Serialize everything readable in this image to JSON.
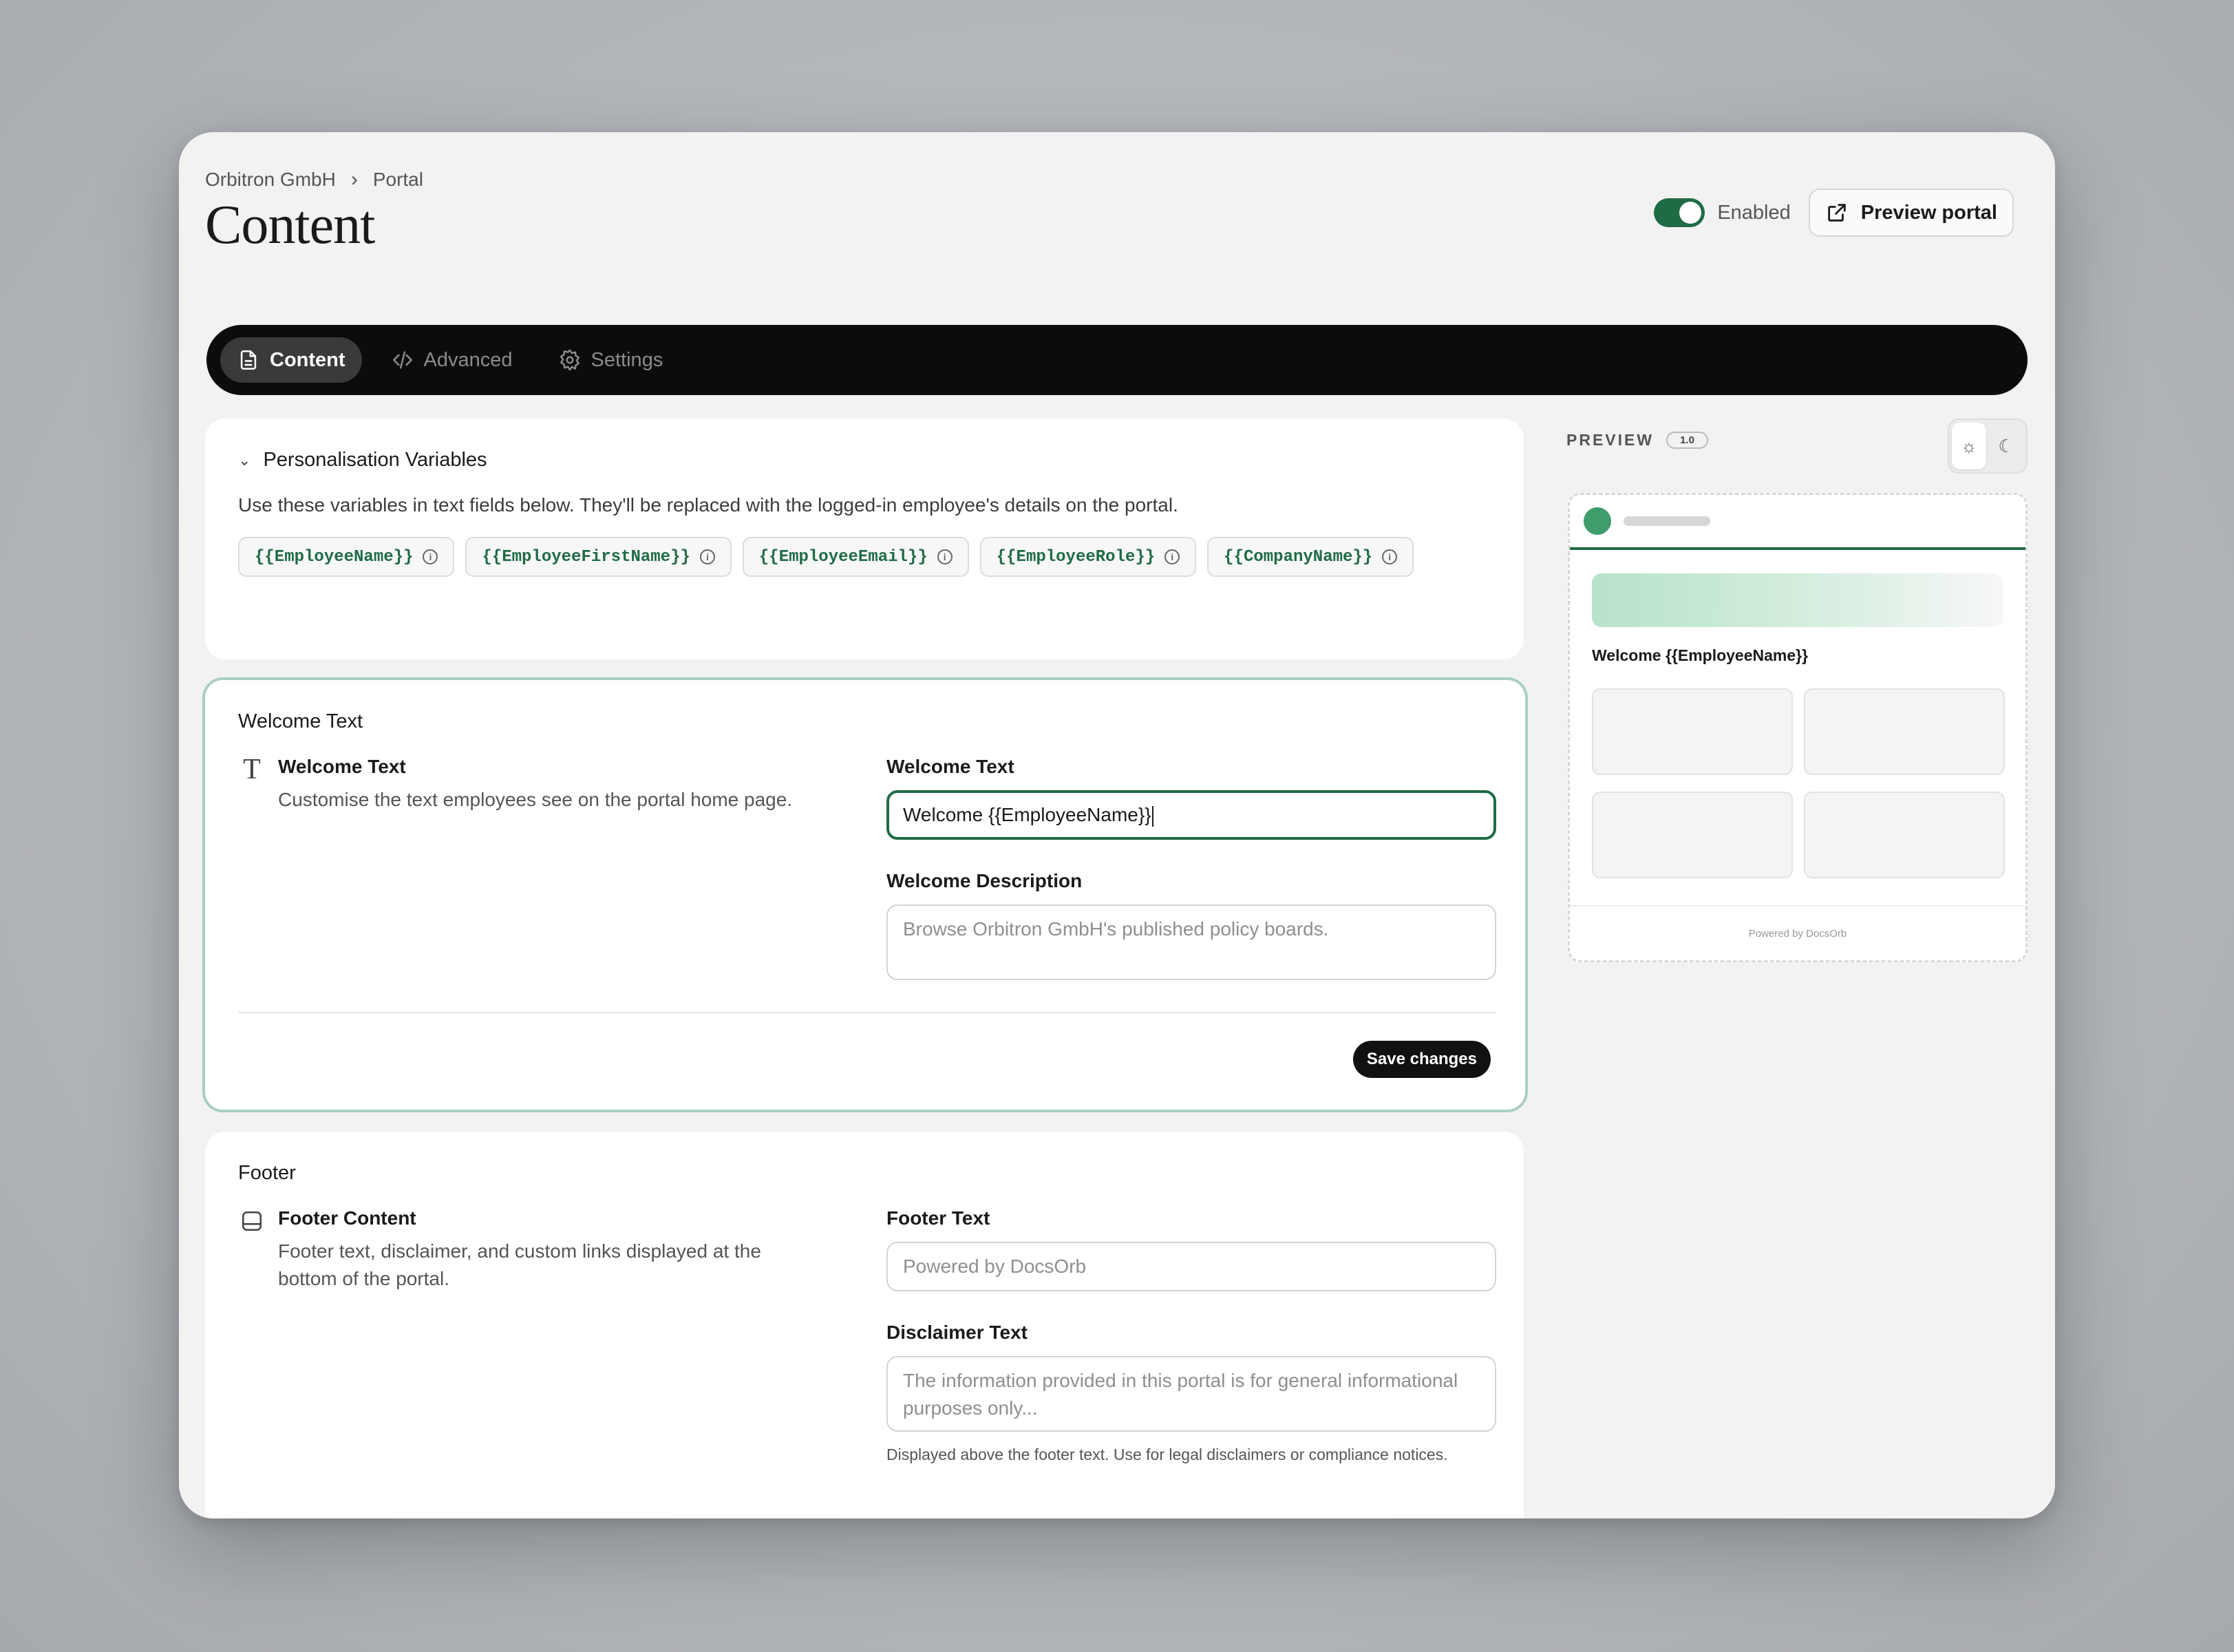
{
  "header": {
    "breadcrumb": [
      "Orbitron GmbH",
      "Portal"
    ],
    "title": "Content",
    "toggle_label": "Enabled",
    "toggle_on": true,
    "preview_button": "Preview portal"
  },
  "tabs": [
    {
      "label": "Content",
      "icon": "file-icon",
      "active": true
    },
    {
      "label": "Advanced",
      "icon": "code-icon",
      "active": false
    },
    {
      "label": "Settings",
      "icon": "gear-icon",
      "active": false
    }
  ],
  "variables": {
    "heading": "Personalisation Variables",
    "description": "Use these variables in text fields below. They'll be replaced with the logged-in employee's details on the portal.",
    "chips": [
      "{{EmployeeName}}",
      "{{EmployeeFirstName}}",
      "{{EmployeeEmail}}",
      "{{EmployeeRole}}",
      "{{CompanyName}}"
    ]
  },
  "welcome": {
    "section_title": "Welcome Text",
    "block_title": "Welcome Text",
    "block_desc": "Customise the text employees see on the portal home page.",
    "text_label": "Welcome Text",
    "text_value": "Welcome {{EmployeeName}}",
    "desc_label": "Welcome Description",
    "desc_placeholder": "Browse Orbitron GmbH's published policy boards.",
    "save_label": "Save changes"
  },
  "footer": {
    "section_title": "Footer",
    "block_title": "Footer Content",
    "block_desc": "Footer text, disclaimer, and custom links displayed at the bottom of the portal.",
    "text_label": "Footer Text",
    "text_placeholder": "Powered by DocsOrb",
    "disclaimer_label": "Disclaimer Text",
    "disclaimer_placeholder": "The information provided in this portal is for general informational purposes only...",
    "disclaimer_help": "Displayed above the footer text. Use for legal disclaimers or compliance notices."
  },
  "preview": {
    "label": "PREVIEW",
    "version": "1.0",
    "welcome": "Welcome {{EmployeeName}}",
    "powered_by": "Powered by DocsOrb"
  },
  "colors": {
    "accent": "#1f6b45",
    "focus_border": "#a9cfc0"
  }
}
